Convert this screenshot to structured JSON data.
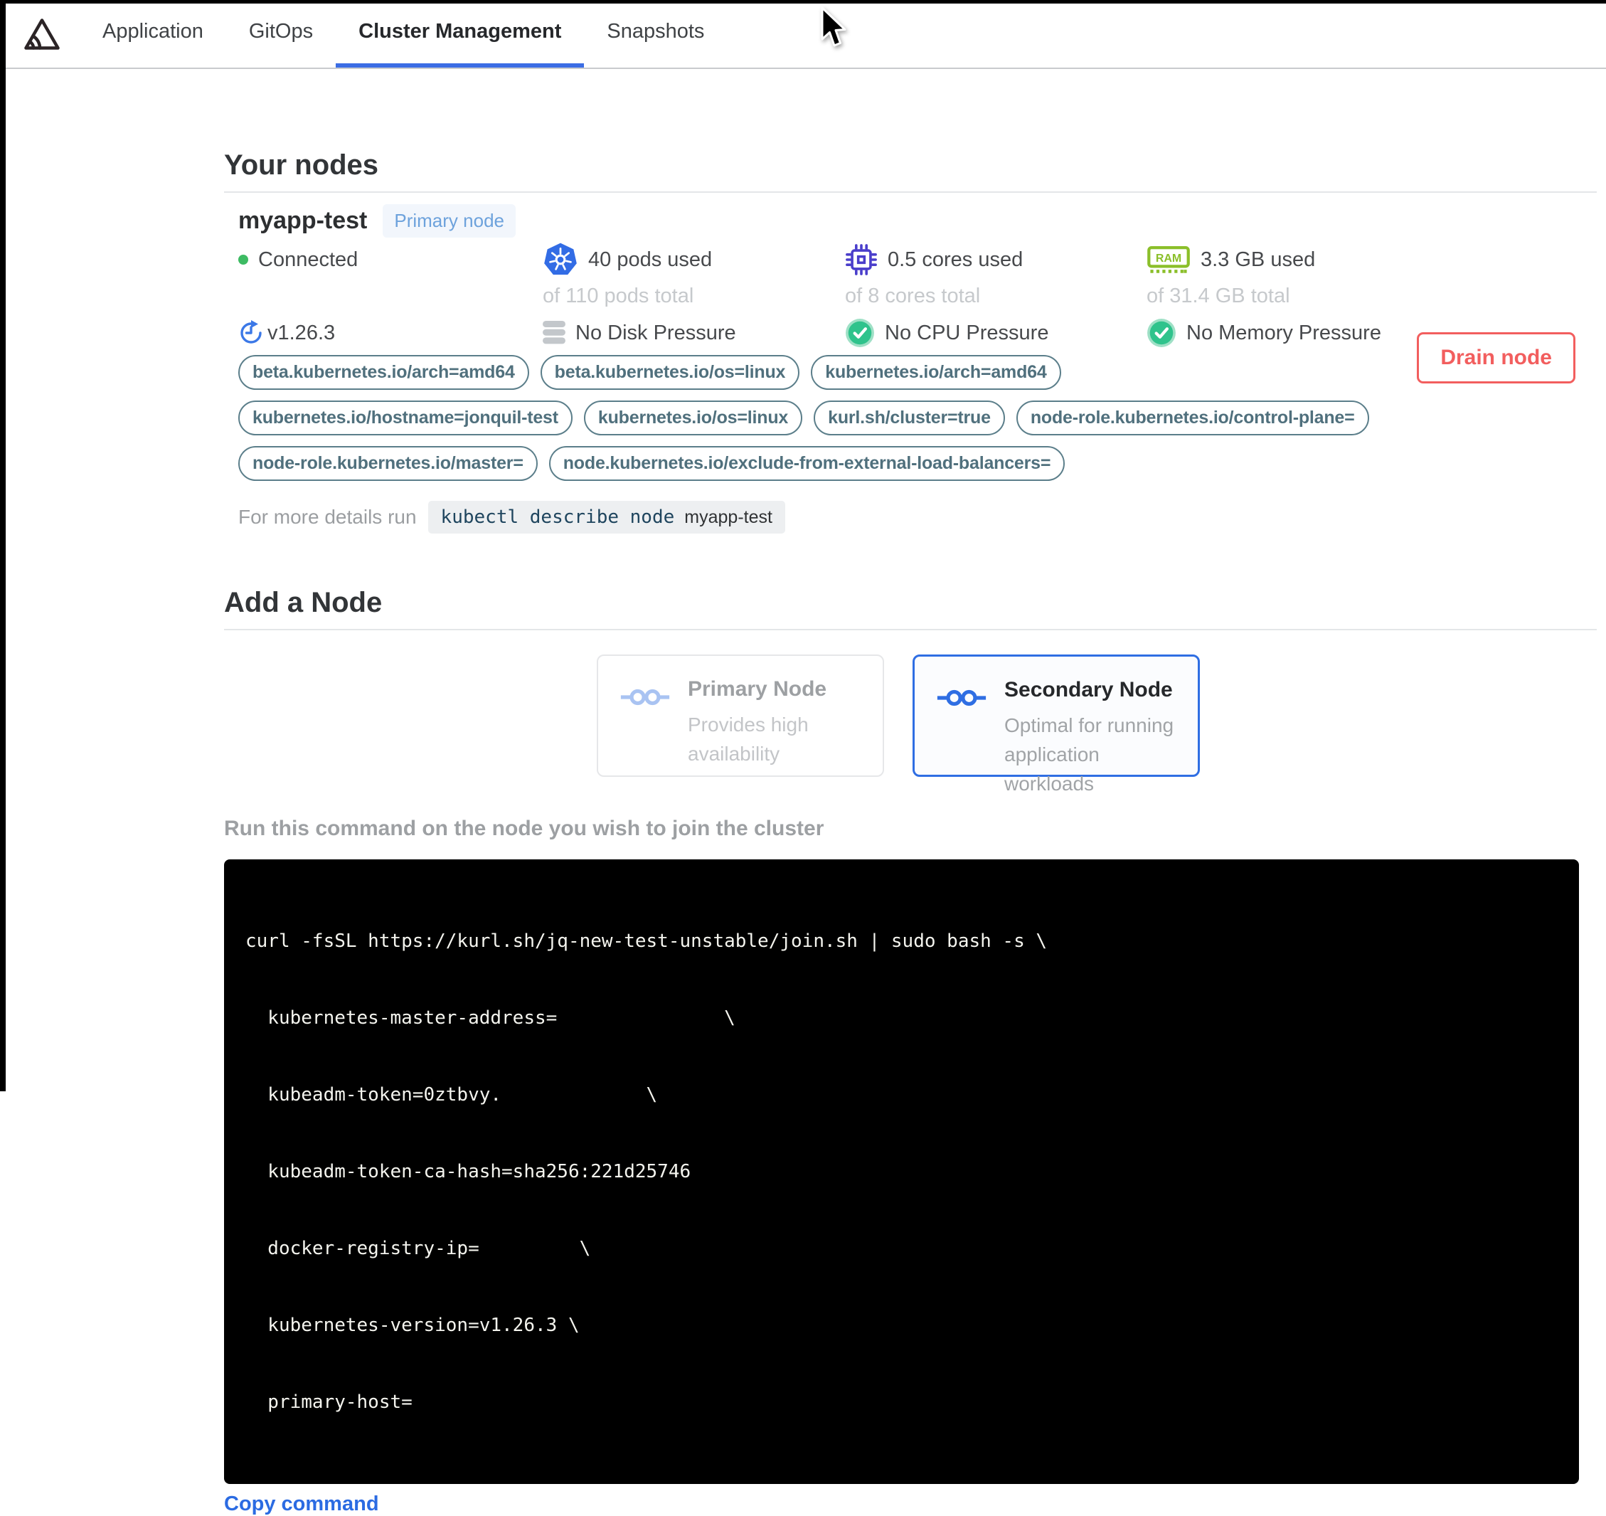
{
  "nav": {
    "logo_icon": "sentry-logo-icon",
    "tabs": [
      {
        "label": "Application",
        "active": false
      },
      {
        "label": "GitOps",
        "active": false
      },
      {
        "label": "Cluster Management",
        "active": true
      },
      {
        "label": "Snapshots",
        "active": false
      }
    ]
  },
  "your_nodes": {
    "title": "Your nodes",
    "node": {
      "name": "myapp-test",
      "badge": "Primary node",
      "status": "Connected",
      "version": "v1.26.3",
      "stats": {
        "pods": {
          "icon": "kubernetes-icon",
          "used": "40 pods used",
          "total": "of 110 pods total"
        },
        "cpu": {
          "icon": "cpu-chip-icon",
          "used": "0.5 cores used",
          "total": "of 8 cores total"
        },
        "memory": {
          "icon": "ram-icon",
          "icon_label": "RAM",
          "used": "3.3 GB used",
          "total": "of 31.4 GB total"
        }
      },
      "pressures": {
        "disk": "No Disk Pressure",
        "cpu": "No CPU Pressure",
        "memory": "No Memory Pressure"
      },
      "labels": [
        "beta.kubernetes.io/arch=amd64",
        "beta.kubernetes.io/os=linux",
        "kubernetes.io/arch=amd64",
        "kubernetes.io/hostname=jonquil-test",
        "kubernetes.io/os=linux",
        "kurl.sh/cluster=true",
        "node-role.kubernetes.io/control-plane=",
        "node-role.kubernetes.io/master=",
        "node.kubernetes.io/exclude-from-external-load-balancers="
      ],
      "details": {
        "prefix": "For more details run",
        "command": "kubectl describe node",
        "node": "myapp-test"
      },
      "drain_button": "Drain node"
    }
  },
  "add_node": {
    "title": "Add a Node",
    "options": [
      {
        "title": "Primary Node",
        "description": "Provides high availability",
        "state": "disabled",
        "icon": "nodes-icon"
      },
      {
        "title": "Secondary Node",
        "description": "Optimal for running application workloads",
        "state": "selected",
        "icon": "nodes-icon"
      }
    ],
    "instruction": "Run this command on the node you wish to join the cluster",
    "command_lines": [
      "curl -fsSL https://kurl.sh/jq-new-test-unstable/join.sh | sudo bash -s \\",
      "  kubernetes-master-address=               \\",
      "  kubeadm-token=0ztbvy.             \\",
      "  kubeadm-token-ca-hash=sha256:221d25746",
      "  docker-registry-ip=         \\",
      "  kubernetes-version=v1.26.3 \\",
      "  primary-host="
    ],
    "copy_button": "Copy command"
  },
  "colors": {
    "accent_blue": "#3b6de4",
    "kubernetes_blue": "#326ce5",
    "cpu_indigo": "#4a3ecb",
    "ram_green": "#8bbf2a",
    "success_green": "#2fc38c",
    "status_green": "#3dbb63",
    "danger_red": "#f25e5e",
    "label_teal": "#50707d",
    "badge_blue": "#6da2dc"
  }
}
